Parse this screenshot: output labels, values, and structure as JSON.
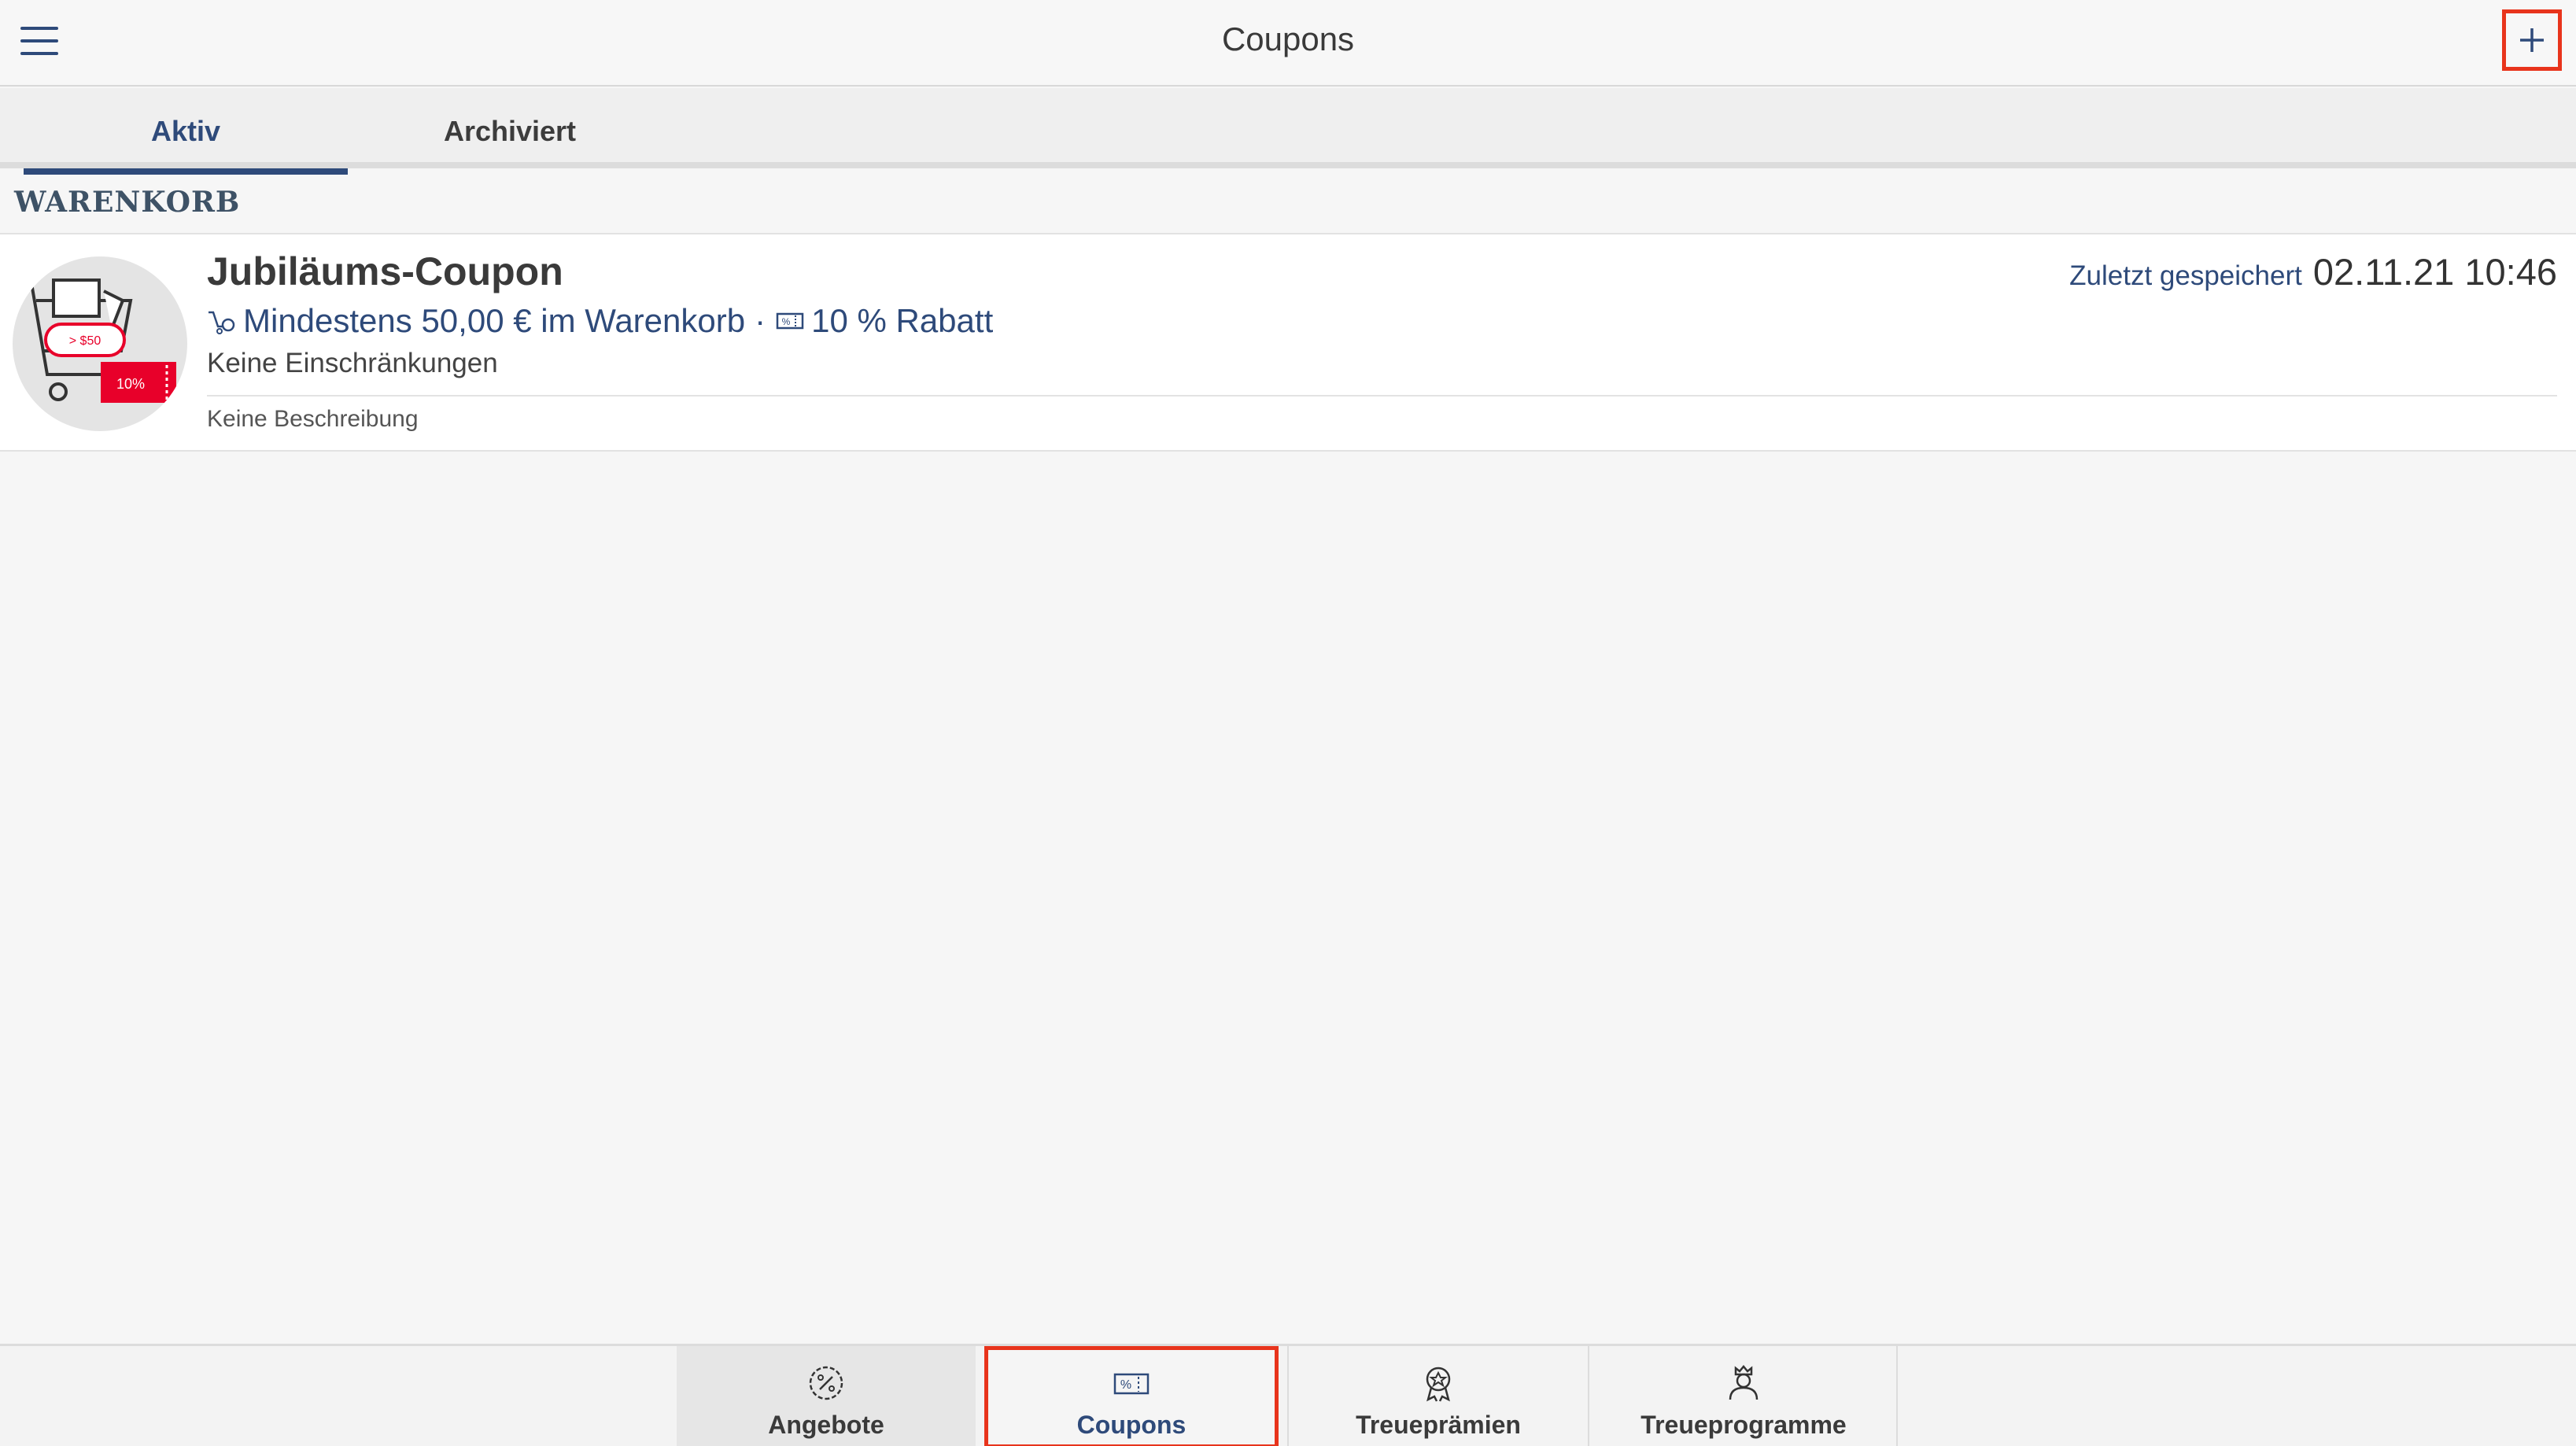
{
  "header": {
    "title": "Coupons",
    "menu_icon": "hamburger-menu-icon",
    "add_icon": "plus-icon"
  },
  "tabs": [
    {
      "label": "Aktiv",
      "active": true
    },
    {
      "label": "Archiviert",
      "active": false
    }
  ],
  "section": {
    "label": "WARENKORB"
  },
  "coupons": [
    {
      "title": "Jubiläums-Coupon",
      "condition": "Mindestens 50,00 € im Warenkorb",
      "separator": "·",
      "discount": "10 % Rabatt",
      "restrictions": "Keine Einschränkungen",
      "description": "Keine Beschreibung",
      "saved_label": "Zuletzt gespeichert",
      "saved_value": "02.11.21 10:46",
      "thumb": {
        "badge": "> $50",
        "tag": "10%"
      }
    }
  ],
  "bottom_nav": [
    {
      "label": "Angebote",
      "icon": "percent-badge-icon"
    },
    {
      "label": "Coupons",
      "icon": "coupon-ticket-icon",
      "active": true
    },
    {
      "label": "Treueprämien",
      "icon": "rosette-award-icon"
    },
    {
      "label": "Treueprogramme",
      "icon": "crowned-person-icon"
    }
  ],
  "colors": {
    "accent": "#2e4a7a",
    "highlight": "#e8341c",
    "background": "#f6f6f6"
  }
}
